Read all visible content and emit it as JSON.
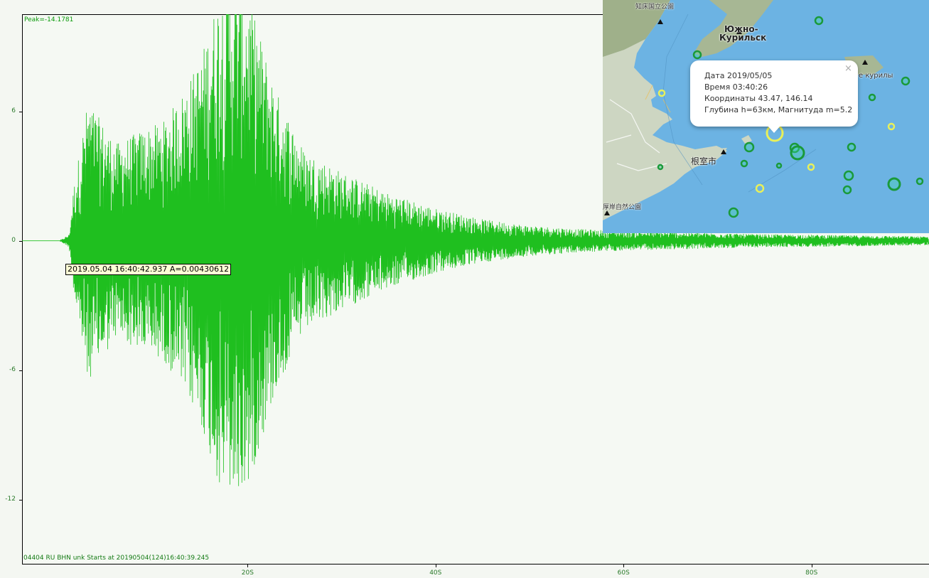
{
  "seismogram": {
    "peak_label": "Peak=-14.1781",
    "station_label": "04404 RU BHN  unk  Starts at 20190504(124)16:40:39.245",
    "cursor_readout": "2019.05.04 16:40:42.937 A=0.00430612",
    "trace_color": "#1fbf1f"
  },
  "chart_data": {
    "type": "line",
    "title": "",
    "xlabel": "",
    "ylabel": "",
    "xlim": [
      -4,
      92.5
    ],
    "ylim": [
      -15,
      10.5
    ],
    "yticks": [
      6,
      0,
      -6,
      -12
    ],
    "ytick_labels": [
      "6",
      "0",
      "-6",
      "-12"
    ],
    "xticks": [
      20,
      40,
      60,
      80
    ],
    "xtick_labels": [
      "20S",
      "40S",
      "60S",
      "80S"
    ],
    "series": [
      {
        "envelope_time_s": [
          0,
          1.0,
          1.5,
          3,
          6,
          9,
          11,
          13,
          15,
          17,
          19,
          20,
          21,
          23,
          26,
          30,
          35,
          40,
          45,
          50,
          55,
          60,
          65,
          70,
          75,
          80,
          85,
          90,
          92.5
        ],
        "envelope_amplitude": [
          0,
          0.3,
          2.5,
          6.5,
          4.5,
          5.2,
          5.5,
          6.8,
          8.5,
          11.5,
          12.0,
          11.5,
          10.0,
          7.0,
          4.2,
          3.2,
          2.2,
          1.5,
          1.0,
          0.7,
          0.55,
          0.45,
          0.4,
          0.35,
          0.3,
          0.28,
          0.25,
          0.22,
          0.2
        ]
      }
    ]
  },
  "map": {
    "labels": {
      "yuzhno": "Южно-",
      "kurilsk": "Курильск",
      "nemuro": "根室市",
      "shiretoko": "知床国立公園",
      "kurily": "е курилы",
      "coastal_park": "厚岸自然公園"
    },
    "popup": {
      "date": "Дата 2019/05/05",
      "time": "Время 03:40:26",
      "coords": "Координаты 43.47, 146.14",
      "depth_mag": "Глубина h=63км, Магнитуда m=5.2",
      "close": "×"
    },
    "colors": {
      "sea": "#6cb3e3",
      "land": "#cfd8c4",
      "marker_green": "#1a9a3a",
      "marker_yellow": "#e8f05a"
    }
  }
}
